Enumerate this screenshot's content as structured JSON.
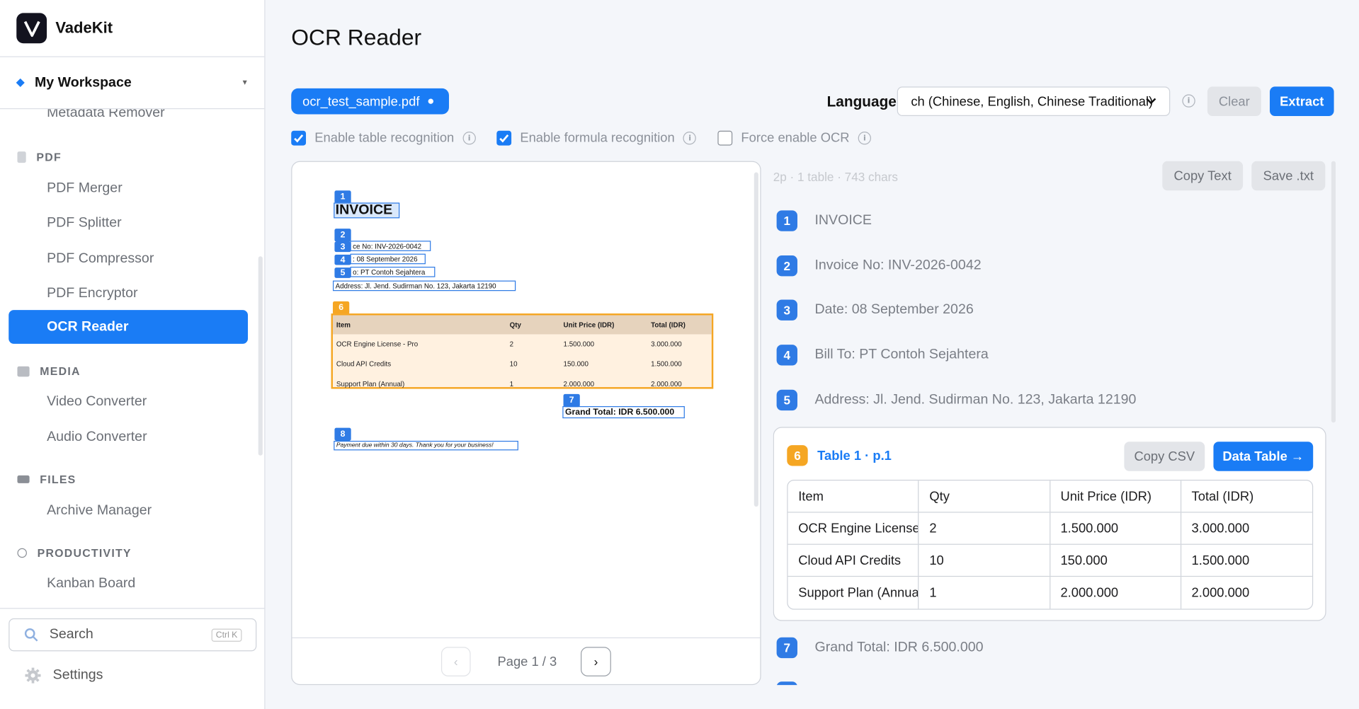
{
  "app": {
    "name": "VadeKit"
  },
  "workspace": {
    "name": "My Workspace"
  },
  "sidebar": {
    "items": [
      {
        "label": "Metadata Remover"
      },
      {
        "label": "PDF"
      },
      {
        "label": "PDF Merger"
      },
      {
        "label": "PDF Splitter"
      },
      {
        "label": "PDF Compressor"
      },
      {
        "label": "PDF Encryptor"
      },
      {
        "label": "OCR Reader"
      },
      {
        "label": "MEDIA"
      },
      {
        "label": "Video Converter"
      },
      {
        "label": "Audio Converter"
      },
      {
        "label": "FILES"
      },
      {
        "label": "Archive Manager"
      },
      {
        "label": "PRODUCTIVITY"
      },
      {
        "label": "Kanban Board"
      }
    ],
    "search": {
      "label": "Search",
      "shortcut": "Ctrl K"
    },
    "settings_label": "Settings",
    "accent": "#1a7cf5"
  },
  "page": {
    "title": "OCR Reader",
    "file_chip": "ocr_test_sample.pdf",
    "language_label": "Language",
    "language_value": "ch (Chinese, English, Chinese Traditional)",
    "clear_label": "Clear",
    "extract_label": "Extract",
    "options": [
      {
        "label": "Enable table recognition",
        "checked": true
      },
      {
        "label": "Enable formula recognition",
        "checked": true
      },
      {
        "label": "Force enable OCR",
        "checked": false
      }
    ]
  },
  "preview": {
    "doc": {
      "title": "INVOICE",
      "lines": [
        "ce No: INV-2026-0042",
        ": 08 September 2026",
        "o: PT Contoh Sejahtera",
        "Address: Jl. Jend. Sudirman No. 123, Jakarta 12190"
      ],
      "table_header": [
        "Item",
        "Qty",
        "Unit Price (IDR)",
        "Total (IDR)"
      ],
      "table_rows": [
        [
          "OCR Engine License - Pro",
          "2",
          "1.500.000",
          "3.000.000"
        ],
        [
          "Cloud API Credits",
          "10",
          "150.000",
          "1.500.000"
        ],
        [
          "Support Plan (Annual)",
          "1",
          "2.000.000",
          "2.000.000"
        ]
      ],
      "grand_total": "Grand Total: IDR 6.500.000",
      "footer": "Payment due within 30 days. Thank you for your business!",
      "tags": [
        "1",
        "2",
        "3",
        "4",
        "5",
        "6",
        "7",
        "8"
      ]
    },
    "prev_label": "‹",
    "next_label": "›",
    "page_label": "Page 1 / 3"
  },
  "results": {
    "meta": "2p · 1 table · 743 chars",
    "copy_text_label": "Copy Text",
    "save_label": "Save .txt",
    "lines": [
      {
        "num": "1",
        "text": "INVOICE"
      },
      {
        "num": "2",
        "text": "Invoice No: INV-2026-0042"
      },
      {
        "num": "3",
        "text": "Date: 08 September 2026"
      },
      {
        "num": "4",
        "text": "Bill To: PT Contoh Sejahtera"
      },
      {
        "num": "5",
        "text": "Address: Jl. Jend. Sudirman No. 123, Jakarta 12190"
      }
    ],
    "table": {
      "num": "6",
      "title": "Table 1 · p.1",
      "copy_csv_label": "Copy CSV",
      "data_table_label": "Data Table →",
      "headers": [
        "Item",
        "Qty",
        "Unit Price (IDR)",
        "Total (IDR)"
      ],
      "rows": [
        [
          "OCR Engine License - Pro",
          "2",
          "1.500.000",
          "3.000.000"
        ],
        [
          "Cloud API Credits",
          "10",
          "150.000",
          "1.500.000"
        ],
        [
          "Support Plan (Annual)",
          "1",
          "2.000.000",
          "2.000.000"
        ]
      ]
    },
    "after_lines": [
      {
        "num": "7",
        "text": "Grand Total: IDR 6.500.000"
      }
    ]
  }
}
